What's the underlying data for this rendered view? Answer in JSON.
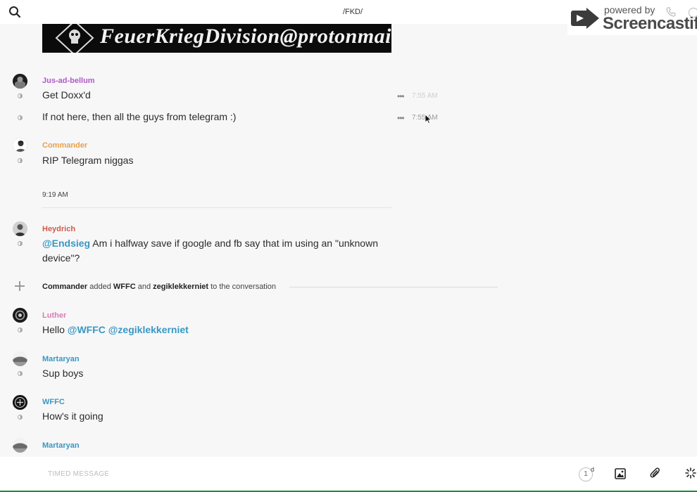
{
  "header": {
    "title": "/FKD/"
  },
  "watermark": {
    "powered_by": "powered by",
    "brand": "Screencastify"
  },
  "banner": {
    "text": "FeuerKriegDivision@protonmail.com"
  },
  "messages": [
    {
      "user": "Jus-ad-bellum",
      "color": "#b05ac8",
      "lines": [
        {
          "text": "Get Doxx'd",
          "time": "7:55 AM"
        },
        {
          "text": "If not here, then all the guys from telegram :)",
          "time": "7:55 AM"
        }
      ]
    },
    {
      "user": "Commander",
      "color": "#e8a04a",
      "lines": [
        {
          "text": "RIP Telegram niggas"
        }
      ]
    },
    {
      "day_time": "9:19 AM"
    },
    {
      "user": "Heydrich",
      "color": "#d25a4a",
      "mention": "@Endsieg",
      "text_line1": " Am i halfway save if google and fb say that im using an \"unknown",
      "text_line2": "device\"?"
    },
    {
      "system": {
        "actor": "Commander",
        "added": "added",
        "user1": "WFFC",
        "and": "and",
        "user2": "zegiklekkerniet",
        "suffix": "to the conversation"
      }
    },
    {
      "user": "Luther",
      "color": "#d97bb0",
      "greeting": "Hello",
      "mention1": "@WFFC",
      "mention2": "@zegiklekkerniet"
    },
    {
      "user": "Martaryan",
      "color": "#3a97c2",
      "text": "Sup boys"
    },
    {
      "user": "WFFC",
      "color": "#3a97c2",
      "text": "How's it going"
    },
    {
      "user": "Martaryan",
      "color": "#3a97c2"
    }
  ],
  "composer": {
    "placeholder": "TIMED MESSAGE",
    "timer_value": "1",
    "timer_unit": "d"
  },
  "icons": [
    "search-icon",
    "screencastify-logo-icon",
    "phone-icon",
    "info-icon",
    "more-icon",
    "plus-icon",
    "timer-icon",
    "image-icon",
    "attach-icon",
    "sparkle-icon",
    "cursor-icon"
  ]
}
